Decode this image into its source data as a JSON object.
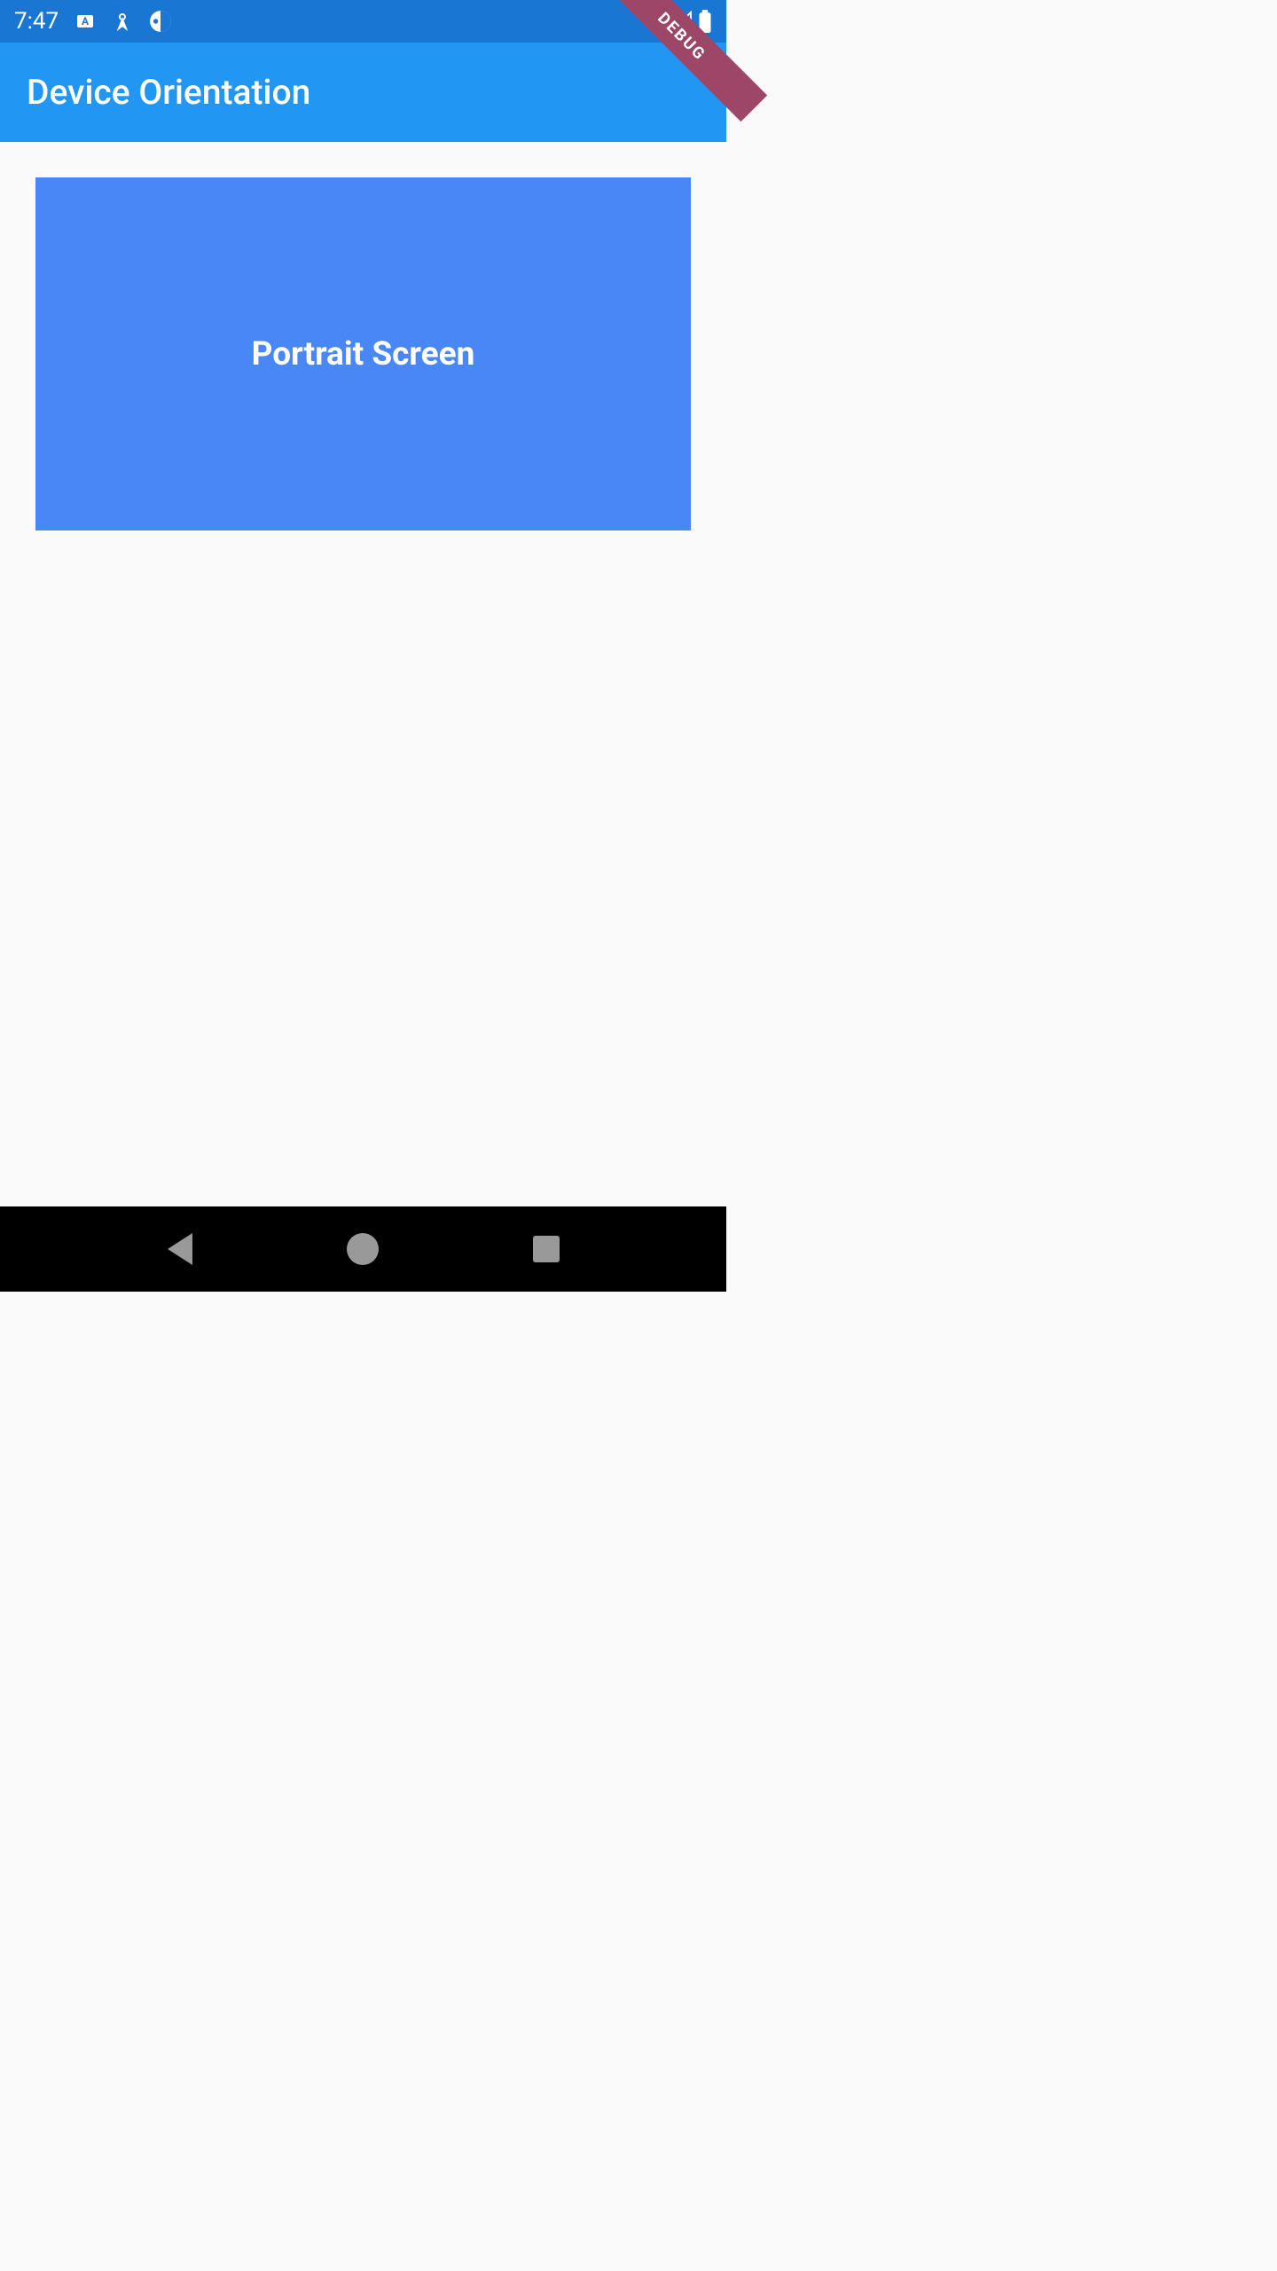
{
  "status": {
    "time": "7:47"
  },
  "app": {
    "title": "Device Orientation"
  },
  "debug": {
    "label": "DEBUG"
  },
  "content": {
    "orientation_label": "Portrait Screen"
  }
}
